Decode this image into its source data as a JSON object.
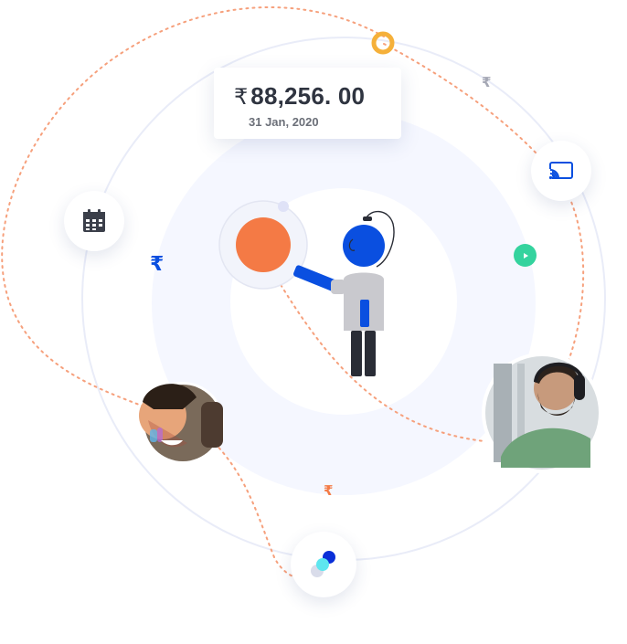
{
  "price_card": {
    "currency_symbol": "₹",
    "amount": "88,256. 00",
    "date": "31 Jan, 2020"
  },
  "floating_rupees": {
    "blue": "₹",
    "grey": "₹",
    "orange": "₹"
  },
  "colors": {
    "orange": "#f47a45",
    "blue": "#0a4fe0",
    "teal": "#34d39e",
    "yellow_ring": "#f5b03a",
    "orbit": "#e8ebf7",
    "dotted_path": "#f6a07c"
  },
  "icons": [
    "calendar-icon",
    "cast-icon",
    "play-icon",
    "app-logo-icon"
  ]
}
